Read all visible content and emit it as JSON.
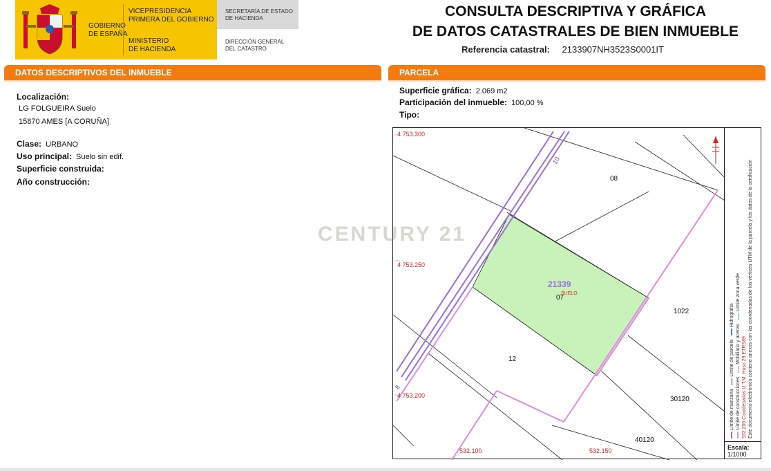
{
  "header": {
    "gobierno": "GOBIERNO\nDE ESPAÑA",
    "vice_line1": "VICEPRESIDENCIA",
    "vice_line2": "PRIMERA DEL GOBIERNO",
    "min_line1": "MINISTERIO",
    "min_line2": "DE HACIENDA",
    "sec_line1": "SECRETARÍA DE ESTADO",
    "sec_line2": "DE HACIENDA",
    "dir_line1": "DIRECCIÓN GENERAL",
    "dir_line2": "DEL CATASTRO",
    "title_line1": "CONSULTA DESCRIPTIVA Y GRÁFICA",
    "title_line2": "DE DATOS CATASTRALES DE BIEN INMUEBLE",
    "ref_label": "Referencia catastral:",
    "ref_value": "2133907NH3523S0001IT"
  },
  "descriptivos": {
    "heading": "DATOS DESCRIPTIVOS DEL INMUEBLE",
    "localizacion_label": "Localización:",
    "localizacion_line1": "LG FOLGUEIRA  Suelo",
    "localizacion_line2": "15870 AMES [A CORUÑA]",
    "clase_label": "Clase:",
    "clase_value": "URBANO",
    "uso_label": "Uso principal:",
    "uso_value": "Suelo sin edif.",
    "superficie_label": "Superficie construida:",
    "anio_label": "Año construcción:"
  },
  "parcela": {
    "heading": "PARCELA",
    "sup_label": "Superficie gráfica:",
    "sup_value": "2.069 m2",
    "part_label": "Participación del inmueble:",
    "part_value": "100,00 %",
    "tipo_label": "Tipo:"
  },
  "map": {
    "y_labels": [
      "4 753.300",
      "4 753.250",
      "4 753.200"
    ],
    "x_labels": [
      "532.100",
      "532.150"
    ],
    "parcel_labels": [
      "08",
      "07",
      "1022",
      "12",
      "30120",
      "40120"
    ],
    "main_parcel": "21339",
    "main_sub": "SUELO",
    "road_labels": [
      "10",
      "8"
    ],
    "legend_lines": [
      "Límite de manzana",
      "Límite de parcela",
      "Hidrografía",
      "Límite de construcciones",
      "Mobiliario y aceras",
      "Límite zona verde",
      "532.200 Coordenadas U.T.M. Huso 29 ETRS89",
      "Este documento electrónico contiene anexos con las coordenadas de los vértices UTM de la parcela y los datos de la certificación"
    ],
    "scale_label": "Escala:",
    "scale_value": "1/1000",
    "colors": {
      "parcel_fill": "#c9f2bb",
      "manzana": "#9b6dde",
      "construcciones": "#e08ae0",
      "coords": "#d22"
    }
  },
  "watermark": "CENTURY 21"
}
